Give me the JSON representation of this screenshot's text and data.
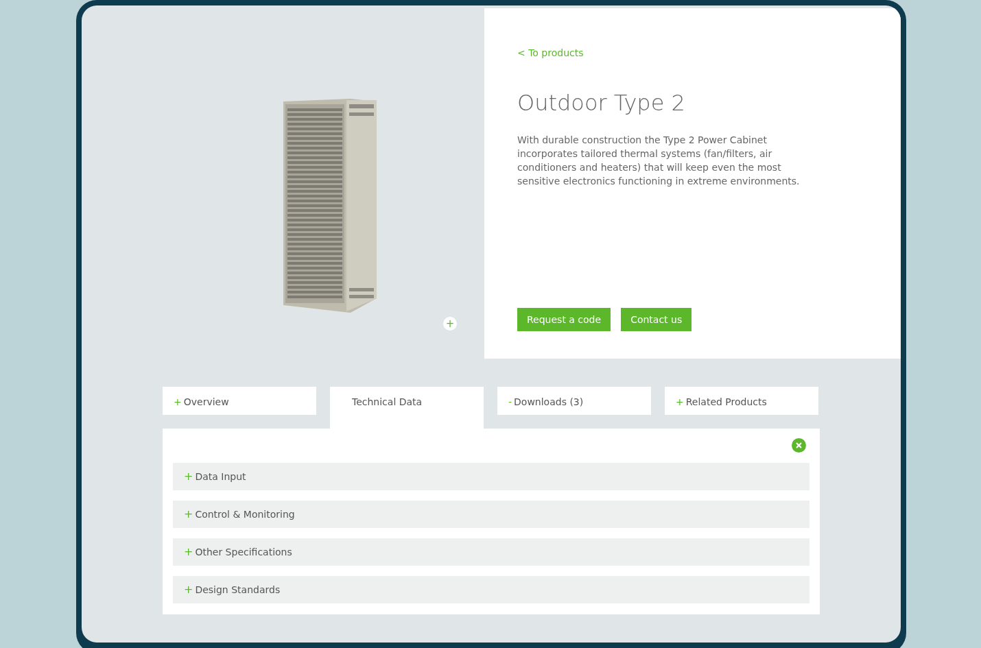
{
  "product_image": {
    "zoom_button": "+"
  },
  "back_link": "< To products",
  "title": "Outdoor Type 2",
  "description": "With durable construction the Type 2 Power Cabinet incorporates tailored thermal systems (fan/filters, air conditioners and heaters) that will keep even the most sensitive electronics functioning in extreme environments.",
  "buttons": [
    "Request a code",
    "Contact us"
  ],
  "tabs": [
    {
      "marker": "+",
      "label": "Overview",
      "selected": false
    },
    {
      "label": "Technical Data",
      "selected": true
    },
    {
      "marker": "-",
      "label": "Downloads (3)",
      "selected": false
    },
    {
      "marker": "+",
      "label": "Related Products",
      "selected": false
    }
  ],
  "sections": [
    {
      "marker": "+",
      "label": "Data Input",
      "expanded": false
    },
    {
      "marker": "+",
      "label": "Control & Monitoring",
      "expanded": false
    },
    {
      "marker": "+",
      "label": "Other Specifications",
      "expanded": false
    },
    {
      "marker": "+",
      "label": "Design Standards",
      "expanded": false
    }
  ]
}
